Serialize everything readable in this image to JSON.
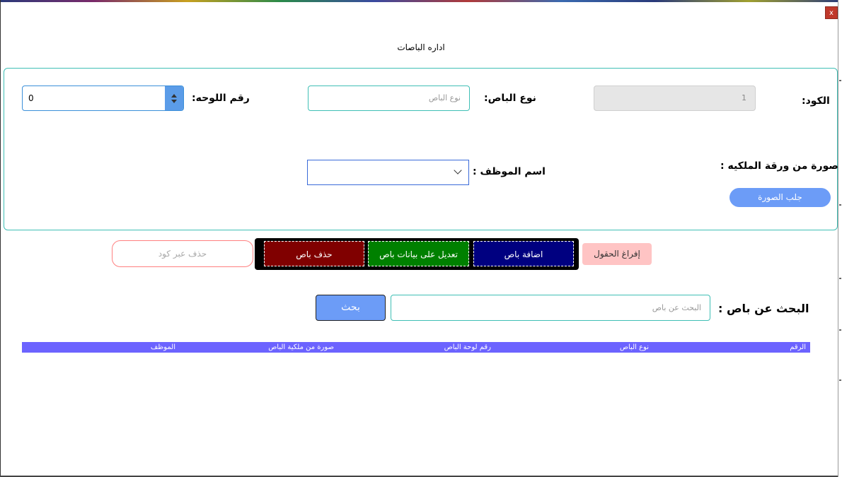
{
  "window": {
    "title": "اداره الباصات",
    "close_label": "x"
  },
  "form": {
    "code_label": "الكود:",
    "code_value": "1",
    "bus_type_label": "نوع الباص:",
    "bus_type_placeholder": "نوع الباص",
    "plate_label": "رقم اللوحه:",
    "plate_value": "0",
    "ownership_image_label": "صورة من ورقة الملكيه :",
    "fetch_image_button": "جلب الصورة",
    "employee_label": "اسم الموظف :",
    "employee_selected": ""
  },
  "actions": {
    "clear_fields": "إفراغ الحقول",
    "add_bus": "اضافة باص",
    "edit_bus": "تعديل على بيانات باص",
    "delete_bus": "حذف باص",
    "delete_by_code_placeholder": "حذف عبر كود"
  },
  "search": {
    "label": "البحث عن باص :",
    "placeholder": "البحث عن باص",
    "button": "بحث"
  },
  "table": {
    "columns": [
      "الرقم",
      "نوع الباص",
      "رقم لوحة الباص",
      "صورة من ملكية الباص",
      "الموظف"
    ]
  },
  "colors": {
    "accent_teal": "#3fbfb5",
    "primary_blue": "#6c9cf7",
    "table_header": "#6c63ff",
    "add": "#000080",
    "edit": "#008000",
    "delete": "#800000",
    "clear": "#ffc4c4"
  }
}
